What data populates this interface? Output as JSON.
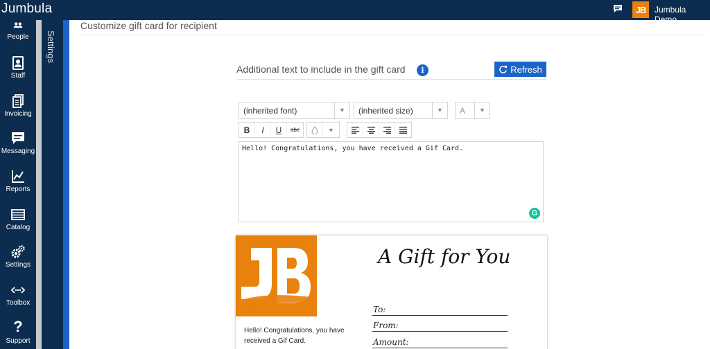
{
  "topbar": {
    "brand": "Jumbula",
    "user_name": "Jumbula Demo",
    "logo_text": "JB",
    "icons": {
      "chat": "chat-icon"
    }
  },
  "nav": {
    "items": [
      {
        "label": "People",
        "icon": "people-icon"
      },
      {
        "label": "Staff",
        "icon": "staff-icon"
      },
      {
        "label": "Invoicing",
        "icon": "invoicing-icon"
      },
      {
        "label": "Messaging",
        "icon": "messaging-icon"
      },
      {
        "label": "Reports",
        "icon": "reports-icon"
      },
      {
        "label": "Catalog",
        "icon": "catalog-icon"
      },
      {
        "label": "Settings",
        "icon": "gear-icon"
      },
      {
        "label": "Toolbox",
        "icon": "toolbox-icon"
      },
      {
        "label": "Support",
        "icon": "question-icon"
      }
    ],
    "panel_label": "Settings"
  },
  "main": {
    "title": "Customize gift card for recipient",
    "section_title": "Additional text to include in the gift card",
    "info_glyph": "i",
    "refresh_label": "Refresh"
  },
  "editor": {
    "font_select": "(inherited font)",
    "size_select": "(inherited size)",
    "color_label": "A",
    "format_buttons": [
      "B",
      "I",
      "U",
      "abc"
    ],
    "content": "Hello! Congratulations, you have received a Gif Card.",
    "grammarly_glyph": "G"
  },
  "card": {
    "heading": "A Gift for You",
    "message": "Hello! Congratulations, you have received a Gif Card.",
    "fields": [
      "To:",
      "From:",
      "Amount:"
    ]
  },
  "colors": {
    "navy": "#0c2d4f",
    "accent_blue": "#1a64c7",
    "brand_orange": "#e8820c",
    "grammarly_green": "#15c39a"
  }
}
